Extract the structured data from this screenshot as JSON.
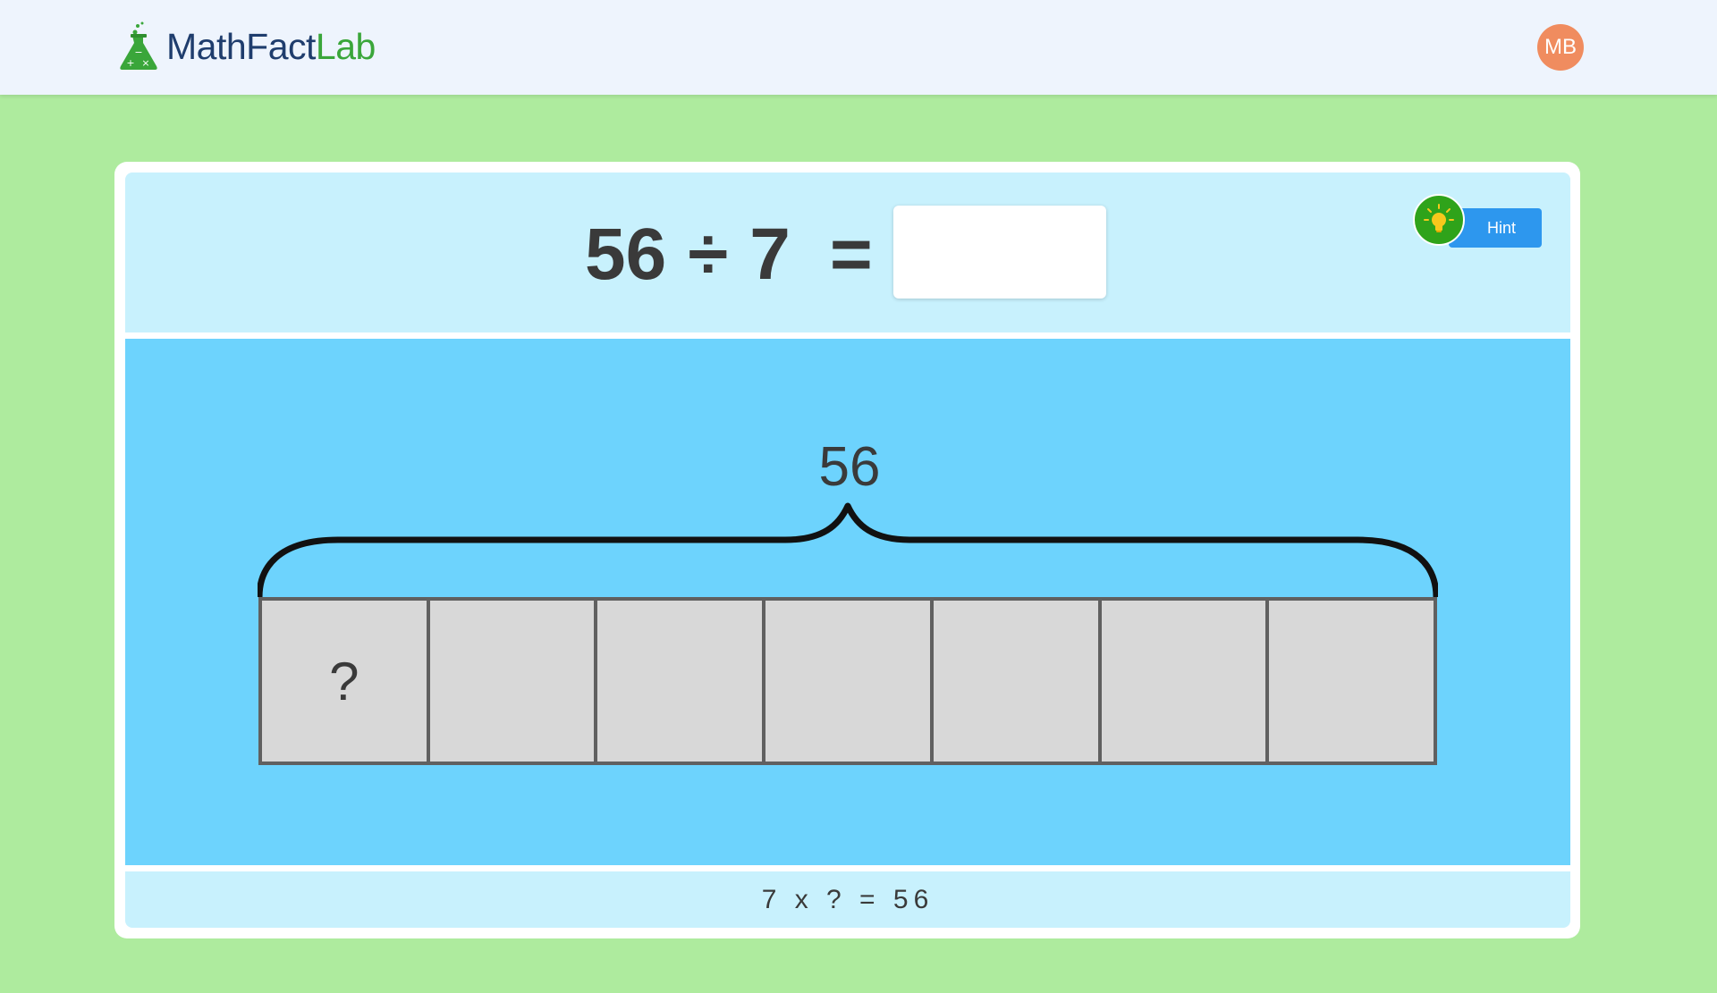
{
  "app": {
    "logo_text_part1": "MathFact",
    "logo_text_part2": "Lab",
    "logo_icon": "flask-icon",
    "user_initials": "MB"
  },
  "problem": {
    "dividend": "56",
    "operator": "÷",
    "divisor": "7",
    "equals": "=",
    "answer_value": ""
  },
  "hint": {
    "label": "Hint",
    "icon": "lightbulb-icon"
  },
  "model": {
    "total": "56",
    "cells": [
      "?",
      "",
      "",
      "",
      "",
      "",
      ""
    ]
  },
  "related_fact": "7 x ? = 56",
  "colors": {
    "page_bg": "#aeeb9e",
    "header_bg": "#eef4fd",
    "brand_dark": "#1f3d6d",
    "brand_green": "#3aa63a",
    "avatar": "#f08c5f",
    "problem_bg": "#c8f1fd",
    "model_bg": "#6dd3fd",
    "hint_button": "#2d97ee",
    "hint_bulb_bg": "#2fa31a",
    "cell_fill": "#d8d8d8"
  }
}
